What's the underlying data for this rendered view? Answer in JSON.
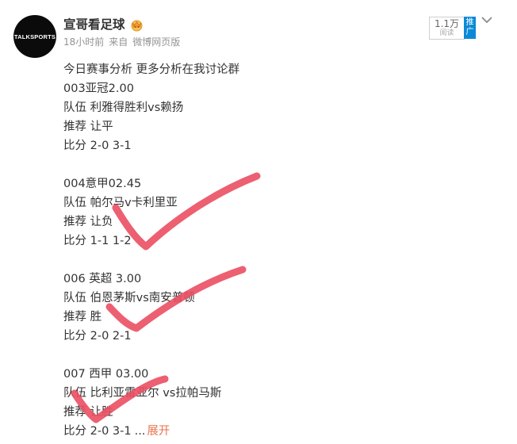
{
  "post": {
    "avatar_text": "TALKSPORTS",
    "author": "宣哥看足球",
    "time": "18小时前",
    "source_prefix": "来自",
    "source": "微博网页版",
    "reads_count": "1.1万",
    "reads_label": "阅读",
    "promote_label": [
      "推",
      "广"
    ],
    "lines": [
      "今日赛事分析 更多分析在我讨论群",
      "003亚冠2.00",
      "队伍 利雅得胜利vs赖扬",
      "推荐 让平",
      "比分 2-0 3-1",
      "",
      "004意甲02.45",
      "队伍 帕尔马v卡利里亚",
      "推荐 让负",
      "比分 1-1 1-2",
      "",
      "006 英超 3.00",
      "队伍 伯恩茅斯vs南安普顿",
      "推荐 胜",
      "比分 2-0 2-1",
      "",
      "007 西甲 03.00",
      "队伍 比利亚雷亚尔 vs拉帕马斯",
      "推荐 让胜"
    ],
    "last_line": "比分 2-0 3-1",
    "ellipsis": "...",
    "expand_label": "展开"
  },
  "colors": {
    "accent_link": "#eb7350",
    "checkmark": "#ea4f62",
    "promote": "#0c8ad8"
  },
  "icons": [
    "crown-icon",
    "chevron-down-icon",
    "checkmark-icon"
  ]
}
